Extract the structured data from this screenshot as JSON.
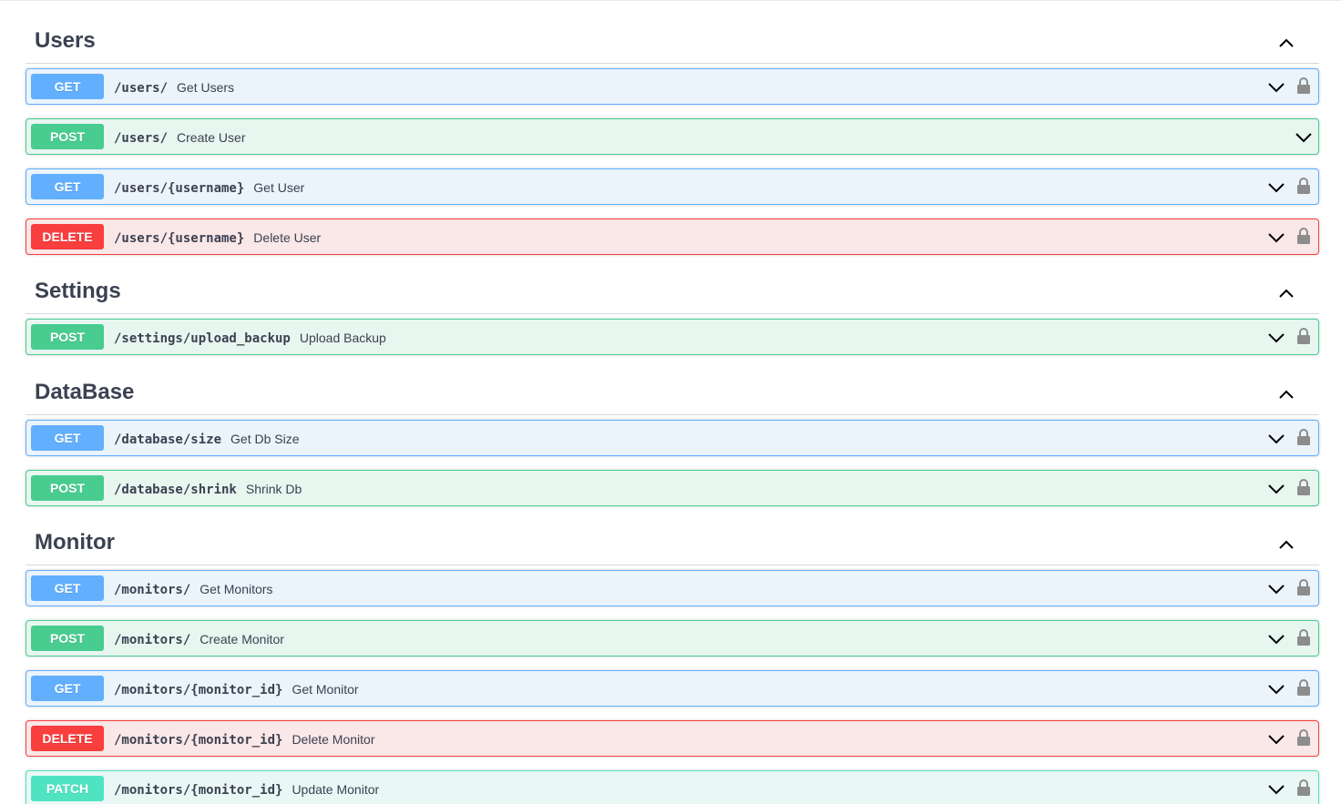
{
  "sections": [
    {
      "id": "users",
      "title": "Users",
      "operations": [
        {
          "method": "GET",
          "path": "/users/",
          "summary": "Get Users",
          "locked": true
        },
        {
          "method": "POST",
          "path": "/users/",
          "summary": "Create User",
          "locked": false
        },
        {
          "method": "GET",
          "path": "/users/{username}",
          "summary": "Get User",
          "locked": true
        },
        {
          "method": "DELETE",
          "path": "/users/{username}",
          "summary": "Delete User",
          "locked": true
        }
      ]
    },
    {
      "id": "settings",
      "title": "Settings",
      "operations": [
        {
          "method": "POST",
          "path": "/settings/upload_backup",
          "summary": "Upload Backup",
          "locked": true
        }
      ]
    },
    {
      "id": "database",
      "title": "DataBase",
      "operations": [
        {
          "method": "GET",
          "path": "/database/size",
          "summary": "Get Db Size",
          "locked": true
        },
        {
          "method": "POST",
          "path": "/database/shrink",
          "summary": "Shrink Db",
          "locked": true
        }
      ]
    },
    {
      "id": "monitor",
      "title": "Monitor",
      "operations": [
        {
          "method": "GET",
          "path": "/monitors/",
          "summary": "Get Monitors",
          "locked": true
        },
        {
          "method": "POST",
          "path": "/monitors/",
          "summary": "Create Monitor",
          "locked": true
        },
        {
          "method": "GET",
          "path": "/monitors/{monitor_id}",
          "summary": "Get Monitor",
          "locked": true
        },
        {
          "method": "DELETE",
          "path": "/monitors/{monitor_id}",
          "summary": "Delete Monitor",
          "locked": true
        },
        {
          "method": "PATCH",
          "path": "/monitors/{monitor_id}",
          "summary": "Update Monitor",
          "locked": true
        }
      ]
    }
  ],
  "icons": {
    "section_toggle": "chevron-up-icon",
    "operation_toggle": "chevron-down-icon",
    "auth": "lock-icon"
  },
  "colors": {
    "GET": "#61affe",
    "POST": "#49cc90",
    "DELETE": "#f93e3e",
    "PATCH": "#50e3c2",
    "text": "#3b4151"
  }
}
